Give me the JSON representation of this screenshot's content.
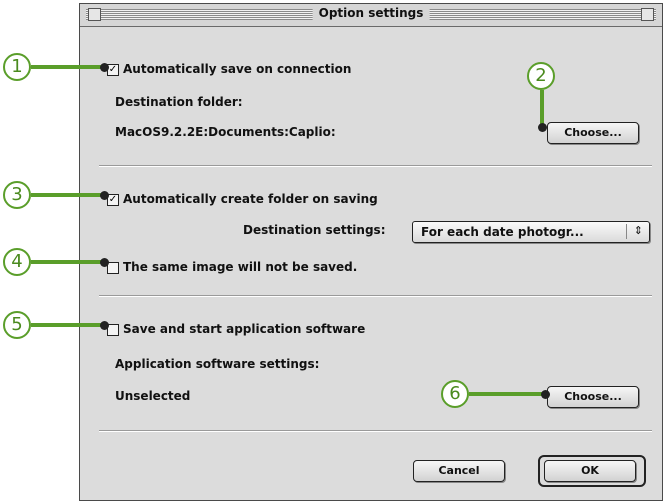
{
  "window": {
    "title": "Option settings"
  },
  "section1": {
    "auto_save_label": "Automatically save on connection",
    "auto_save_checked": true,
    "destination_label": "Destination folder:",
    "destination_path": "MacOS9.2.2E:Documents:Caplio:",
    "choose_label": "Choose..."
  },
  "section2": {
    "auto_folder_label": "Automatically create folder on saving",
    "auto_folder_checked": true,
    "dest_settings_label": "Destination settings:",
    "dest_settings_value": "For each date photogr...",
    "same_image_label": "The same image will not be saved.",
    "same_image_checked": false
  },
  "section3": {
    "save_start_label": "Save and start application software",
    "save_start_checked": false,
    "app_settings_label": "Application software settings:",
    "app_value": "Unselected",
    "choose_label": "Choose..."
  },
  "footer": {
    "cancel_label": "Cancel",
    "ok_label": "OK"
  },
  "callouts": [
    "1",
    "2",
    "3",
    "4",
    "5",
    "6"
  ],
  "colors": {
    "callout_green": "#5a9e2a",
    "dialog_bg": "#dcdcdc"
  }
}
